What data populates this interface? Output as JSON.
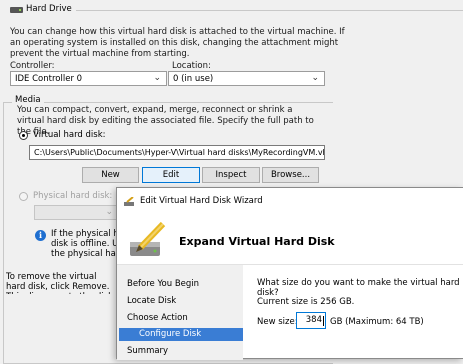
{
  "hard_drive": {
    "title": "Hard Drive",
    "description": "You can change how this virtual hard disk is attached to the virtual machine. If an operating system is installed on this disk, changing the attachment might prevent the virtual machine from starting.",
    "controller_label": "Controller:",
    "controller_value": "IDE Controller 0",
    "location_label": "Location:",
    "location_value": "0 (in use)"
  },
  "media": {
    "title": "Media",
    "description": "You can compact, convert, expand, merge, reconnect or shrink a virtual hard disk by editing the associated file. Specify the full path to the file.",
    "vhd_radio_label": "Virtual hard disk:",
    "vhd_path": "C:\\Users\\Public\\Documents\\Hyper-V\\Virtual hard disks\\MyRecordingVM.vhdx",
    "buttons": {
      "new": "New",
      "edit": "Edit",
      "inspect": "Inspect",
      "browse": "Browse..."
    },
    "physical_radio_label": "Physical hard disk:",
    "info_lines": [
      "If the physical hard",
      "disk is offline. Use",
      "the physical hard"
    ],
    "remove_text": "To remove the virtual hard disk, click Remove. This disconnects the disk but does not delete the associated file."
  },
  "wizard": {
    "title": "Edit Virtual Hard Disk Wizard",
    "heading": "Expand Virtual Hard Disk",
    "nav": [
      "Before You Begin",
      "Locate Disk",
      "Choose Action",
      "Configure Disk",
      "Summary"
    ],
    "selected_nav_index": 3,
    "question": "What size do you want to make the virtual hard disk?",
    "current_size": "Current size is 256 GB.",
    "new_size_label": "New size:",
    "new_size_value": "384",
    "unit_text": "GB (Maximum: 64 TB)"
  }
}
